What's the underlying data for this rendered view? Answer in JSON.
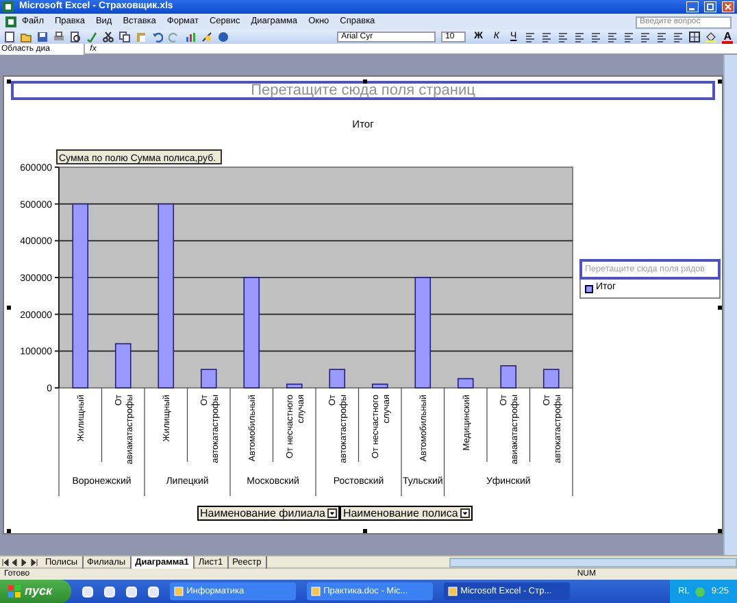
{
  "window": {
    "title": "Microsoft Excel - Страховщик.xls"
  },
  "menu": [
    "Файл",
    "Правка",
    "Вид",
    "Вставка",
    "Формат",
    "Сервис",
    "Диаграмма",
    "Окно",
    "Справка"
  ],
  "help_box": {
    "placeholder": "Введите вопрос"
  },
  "toolbar": {
    "font": "Arial Cyr",
    "font_size": "10",
    "format_buttons": [
      "Ж",
      "К",
      "Ч"
    ],
    "font_color_button": "A"
  },
  "formula_bar": {
    "name_box": "Область диа",
    "function_label": "fx"
  },
  "chart": {
    "page_drop_zone": "Перетащите сюда поля страниц",
    "data_field_button": "Сумма по полю Сумма полиса,руб.",
    "chart_data": {
      "type": "bar",
      "title": "Итог",
      "grid": true,
      "series": [
        {
          "name": "Итог",
          "color": "#9999ff",
          "values": [
            500000,
            120000,
            500000,
            50000,
            300000,
            10000,
            50000,
            10000,
            300000,
            25000,
            60000,
            50000
          ]
        }
      ],
      "ylim": [
        0,
        600000
      ],
      "yticks": [
        0,
        100000,
        200000,
        300000,
        400000,
        500000,
        600000
      ]
    },
    "category_groups": [
      {
        "label": "Воронежский",
        "categories": [
          "Жилищный",
          "От авиакатастрофы"
        ]
      },
      {
        "label": "Липецкий",
        "categories": [
          "Жилищный",
          "От автокатастрофы"
        ]
      },
      {
        "label": "Московский",
        "categories": [
          "Автомобильный",
          "От несчастного случая"
        ]
      },
      {
        "label": "Ростовский",
        "categories": [
          "От автокатастрофы",
          "От несчастного случая"
        ]
      },
      {
        "label": "Тульский",
        "categories": [
          "Автомобильный"
        ]
      },
      {
        "label": "Уфинский",
        "categories": [
          "Медицинский",
          "От авиакатастрофы",
          "От автокатастрофы"
        ]
      }
    ],
    "series_drop_zone": "Перетащите сюда поля рядов",
    "field_buttons": [
      "Наименование филиала",
      "Наименование полиса"
    ]
  },
  "sheet_tabs": [
    {
      "label": "Полисы",
      "selected": false
    },
    {
      "label": "Филиалы",
      "selected": false
    },
    {
      "label": "Диаграмма1",
      "selected": true
    },
    {
      "label": "Лист1",
      "selected": false
    },
    {
      "label": "Реестр",
      "selected": false
    }
  ],
  "status_bar": {
    "text": "Готово",
    "indicator": "NUM"
  },
  "taskbar": {
    "start": "пуск",
    "tasks": [
      {
        "label": "Информатика",
        "selected": false
      },
      {
        "label": "Практика.doc - Mic...",
        "selected": false
      },
      {
        "label": "Microsoft Excel - Стр...",
        "selected": true
      }
    ],
    "language": "RL",
    "clock": "9:25"
  }
}
